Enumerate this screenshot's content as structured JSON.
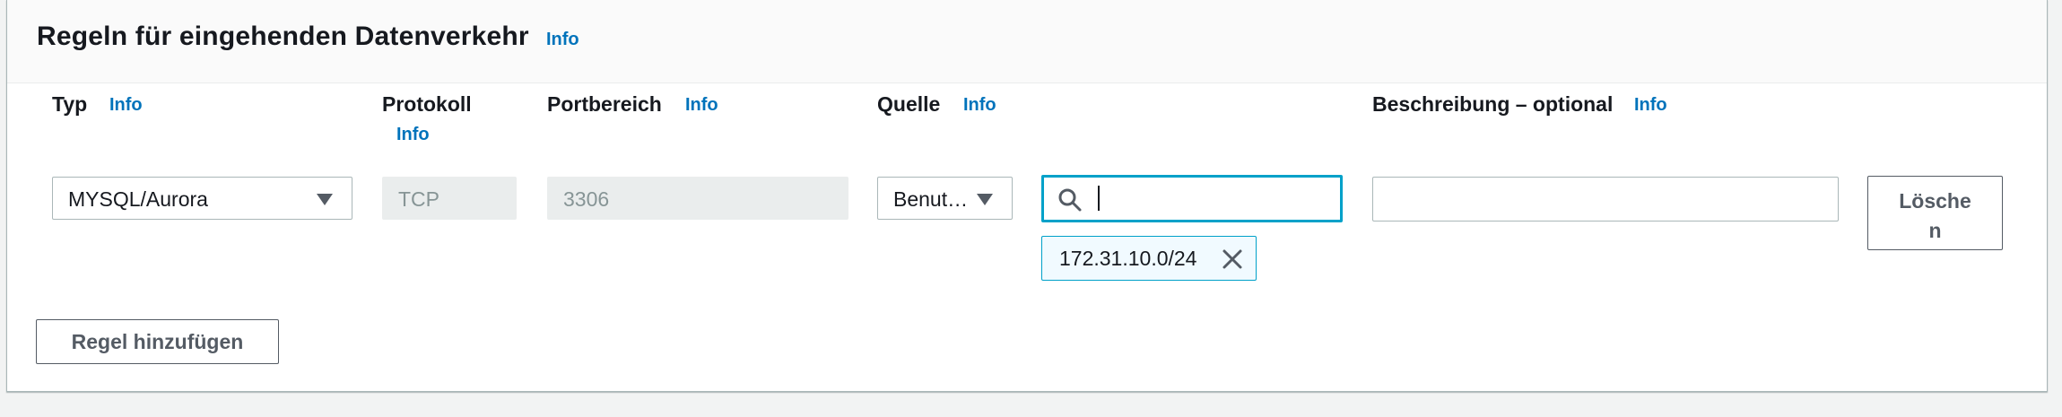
{
  "section": {
    "title": "Regeln für eingehenden Datenverkehr",
    "info": "Info"
  },
  "columns": {
    "type": {
      "label": "Typ",
      "info": "Info"
    },
    "protocol": {
      "label": "Protokoll",
      "info": "Info"
    },
    "port_range": {
      "label": "Portbereich",
      "info": "Info"
    },
    "source": {
      "label": "Quelle",
      "info": "Info"
    },
    "description": {
      "label": "Beschreibung – optional",
      "info": "Info"
    }
  },
  "rule": {
    "type_value": "MYSQL/Aurora",
    "protocol_value": "TCP",
    "port_value": "3306",
    "source_type_value": "Benut…",
    "source_search_value": "",
    "source_token": "172.31.10.0/24",
    "description_value": "",
    "delete_label_line1": "Lösche",
    "delete_label_line2": "n"
  },
  "actions": {
    "add_rule_label": "Regel hinzufügen"
  },
  "icons": {
    "type_dropdown": "caret-down-icon",
    "source_dropdown": "caret-down-icon",
    "search": "search-icon",
    "remove_token": "close-icon"
  },
  "colors": {
    "link": "#0073bb",
    "focus": "#00a1c9",
    "token_bg": "#f1faff",
    "disabled_bg": "#eaeded"
  }
}
